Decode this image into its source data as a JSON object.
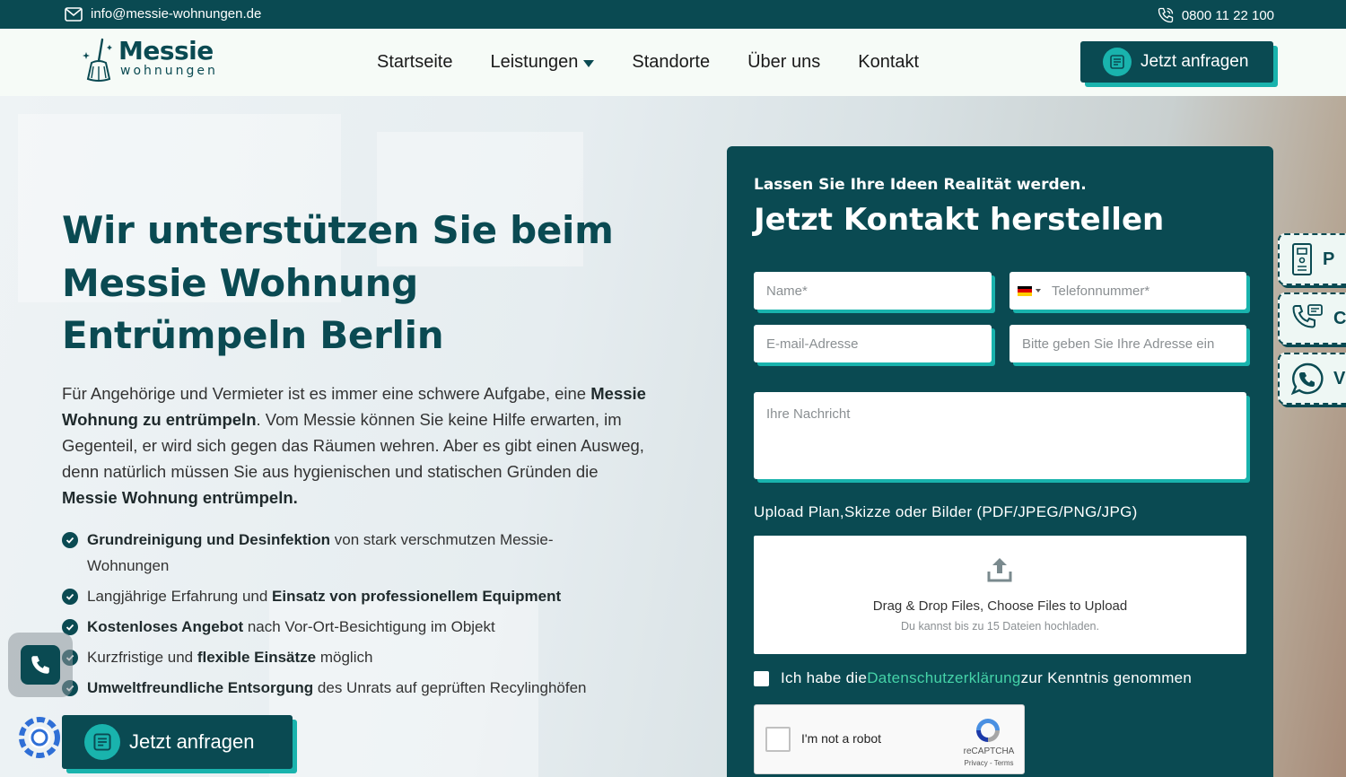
{
  "topbar": {
    "email": "info@messie-wohnungen.de",
    "phone": "0800 11 22 100"
  },
  "brand": {
    "title": "Messie",
    "subtitle": "wohnungen"
  },
  "nav": {
    "items": [
      {
        "label": "Startseite"
      },
      {
        "label": "Leistungen",
        "has_dropdown": true
      },
      {
        "label": "Standorte"
      },
      {
        "label": "Über uns"
      },
      {
        "label": "Kontakt"
      }
    ],
    "cta_label": "Jetzt anfragen"
  },
  "hero": {
    "heading_line1": "Wir unterstützen Sie beim",
    "heading_line2": "Messie Wohnung",
    "heading_line3": "Entrümpeln Berlin",
    "intro_pre": "Für Angehörige und Vermieter ist es immer eine schwere Aufgabe, eine ",
    "intro_bold1": "Messie Wohnung zu entrümpeln",
    "intro_mid": ". Vom Messie können Sie keine Hilfe erwarten, im Gegenteil, er wird sich gegen das Räumen wehren. Aber es gibt einen Ausweg, denn natürlich müssen Sie aus hygienischen und statischen Gründen die ",
    "intro_bold2": "Messie Wohnung entrümpeln.",
    "features": [
      {
        "pre": "",
        "bold": "Grundreinigung und Desinfektion",
        "post": " von stark verschmutzen Messie-Wohnungen"
      },
      {
        "pre": "Langjährige Erfahrung und ",
        "bold": "Einsatz von professionellem Equipment",
        "post": ""
      },
      {
        "pre": "",
        "bold": "Kostenloses Angebot",
        "post": " nach Vor-Ort-Besichtigung im Objekt"
      },
      {
        "pre": "Kurzfristige und ",
        "bold": "flexible Einsätze",
        "post": " möglich"
      },
      {
        "pre": "",
        "bold": "Umweltfreundliche Entsorgung",
        "post": " des Unrats auf geprüften Recylinghöfen"
      }
    ],
    "cta_label": "Jetzt anfragen"
  },
  "form": {
    "kicker": "Lassen Sie Ihre Ideen Realität werden.",
    "title": "Jetzt Kontakt herstellen",
    "name_placeholder": "Name*",
    "phone_placeholder": "Telefonnummer*",
    "email_placeholder": "E-mail-Adresse",
    "address_placeholder": "Bitte geben Sie Ihre Adresse ein",
    "message_placeholder": "Ihre Nachricht",
    "upload_label": "Upload Plan,Skizze oder Bilder (PDF/JPEG/PNG/JPG)",
    "dropzone_main": "Drag & Drop Files, Choose Files to Upload",
    "dropzone_sub": "Du kannst bis zu 15 Dateien hochladen.",
    "consent_pre": "Ich habe die ",
    "consent_link": "Datenschutzerklärung",
    "consent_post": " zur Kenntnis genommen",
    "recaptcha_label": "I'm not a robot",
    "recaptcha_brand": "reCAPTCHA",
    "recaptcha_terms": "Privacy - Terms"
  },
  "side_tabs": [
    {
      "icon": "intercom-icon",
      "label": "P"
    },
    {
      "icon": "phone-chat-icon",
      "label": "C"
    },
    {
      "icon": "whatsapp-icon",
      "label": "V"
    }
  ],
  "colors": {
    "primary": "#0a4a52",
    "accent": "#19b3ad",
    "link": "#45d3a8"
  }
}
